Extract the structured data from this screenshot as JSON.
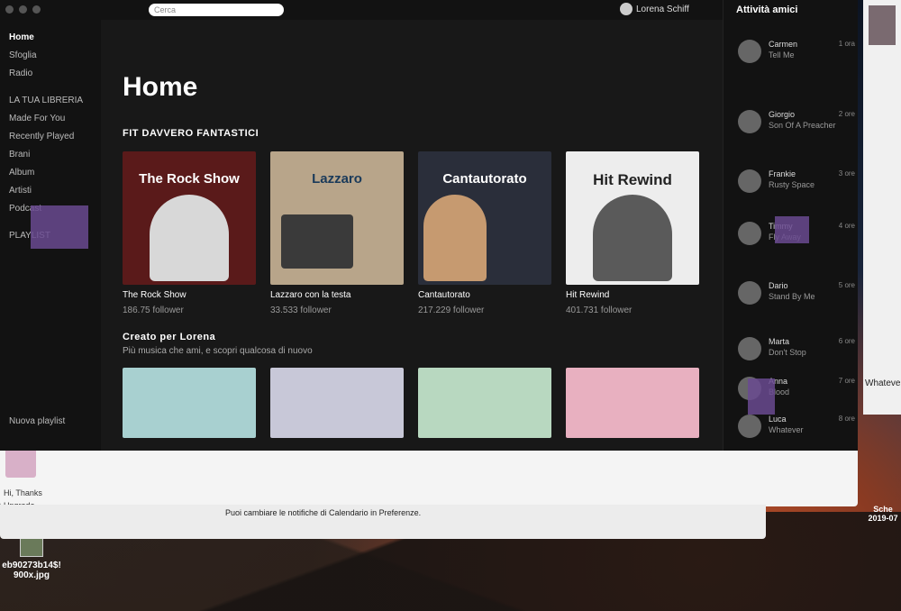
{
  "topbar": {
    "search_placeholder": "Cerca",
    "user_name": "Lorena Schiff"
  },
  "sidebar": {
    "items": [
      {
        "label": "Home",
        "strong": true
      },
      {
        "label": "Sfoglia",
        "strong": false
      },
      {
        "label": "Radio",
        "strong": false
      },
      {
        "label": "LA TUA LIBRERIA",
        "strong": false
      },
      {
        "label": "Made For You",
        "strong": false
      },
      {
        "label": "Recently Played",
        "strong": false
      },
      {
        "label": "Brani",
        "strong": false
      },
      {
        "label": "Album",
        "strong": false
      },
      {
        "label": "Artisti",
        "strong": false
      },
      {
        "label": "Podcast",
        "strong": false
      },
      {
        "label": "PLAYLIST",
        "strong": false
      },
      {
        "label": "Nuova playlist",
        "strong": false
      }
    ]
  },
  "main": {
    "page_title": "Home",
    "section1": {
      "title": "FIT DAVVERO FANTASTICI",
      "cards": [
        {
          "cover_text": "The Rock Show",
          "name": "The Rock Show",
          "followers": "186.75 follower",
          "bg": "#5a1a1a",
          "fig": "#d8d8d8"
        },
        {
          "cover_text": "Lazzaro",
          "name": "Lazzaro con la testa",
          "followers": "33.533 follower",
          "bg": "#b8a58a",
          "fig": "#3a3a3a"
        },
        {
          "cover_text": "Cantautorato",
          "name": "Cantautorato",
          "followers": "217.229 follower",
          "bg": "#2a2e3a",
          "fig": "#c69a70"
        },
        {
          "cover_text": "Hit Rewind",
          "name": "Hit Rewind",
          "followers": "401.731 follower",
          "bg": "#ededed",
          "fig": "#5a5a5a"
        }
      ]
    },
    "section2": {
      "title": "Creato per Lorena",
      "subtitle": "Più musica che ami, e scopri qualcosa di nuovo",
      "cards": [
        {
          "bg": "#a8d0d0"
        },
        {
          "bg": "#c8c8d8"
        },
        {
          "bg": "#b8d8c0"
        },
        {
          "bg": "#e8b0c0"
        }
      ]
    }
  },
  "friends": {
    "header": "Attività amici",
    "list": [
      {
        "name": "Carmen",
        "time": "1 ora",
        "track": "Tell Me"
      },
      {
        "name": "Giorgio",
        "time": "2 ore",
        "track": "Son Of A Preacher"
      },
      {
        "name": "Frankie",
        "time": "3 ore",
        "track": "Rusty Space"
      },
      {
        "name": "Timmy",
        "time": "4 ore",
        "track": "Fly Away"
      },
      {
        "name": "Dario",
        "time": "5 ore",
        "track": "Stand By Me"
      },
      {
        "name": "Marta",
        "time": "6 ore",
        "track": "Don't Stop"
      },
      {
        "name": "Anna",
        "time": "7 ore",
        "track": "Blood"
      },
      {
        "name": "Luca",
        "time": "8 ore",
        "track": "Whatever"
      }
    ]
  },
  "whatsapp": {
    "message_preview": "Hi, Thanks",
    "upgrade": "Upgrade",
    "notice": "Puoi cambiare le notifiche di Calendario in Preferenze."
  },
  "right_panel": {
    "label": "Whatever"
  },
  "desktop": {
    "file_name": "eb90273b14$! 900x.jpg",
    "right_label": "Sche 2019-07"
  }
}
